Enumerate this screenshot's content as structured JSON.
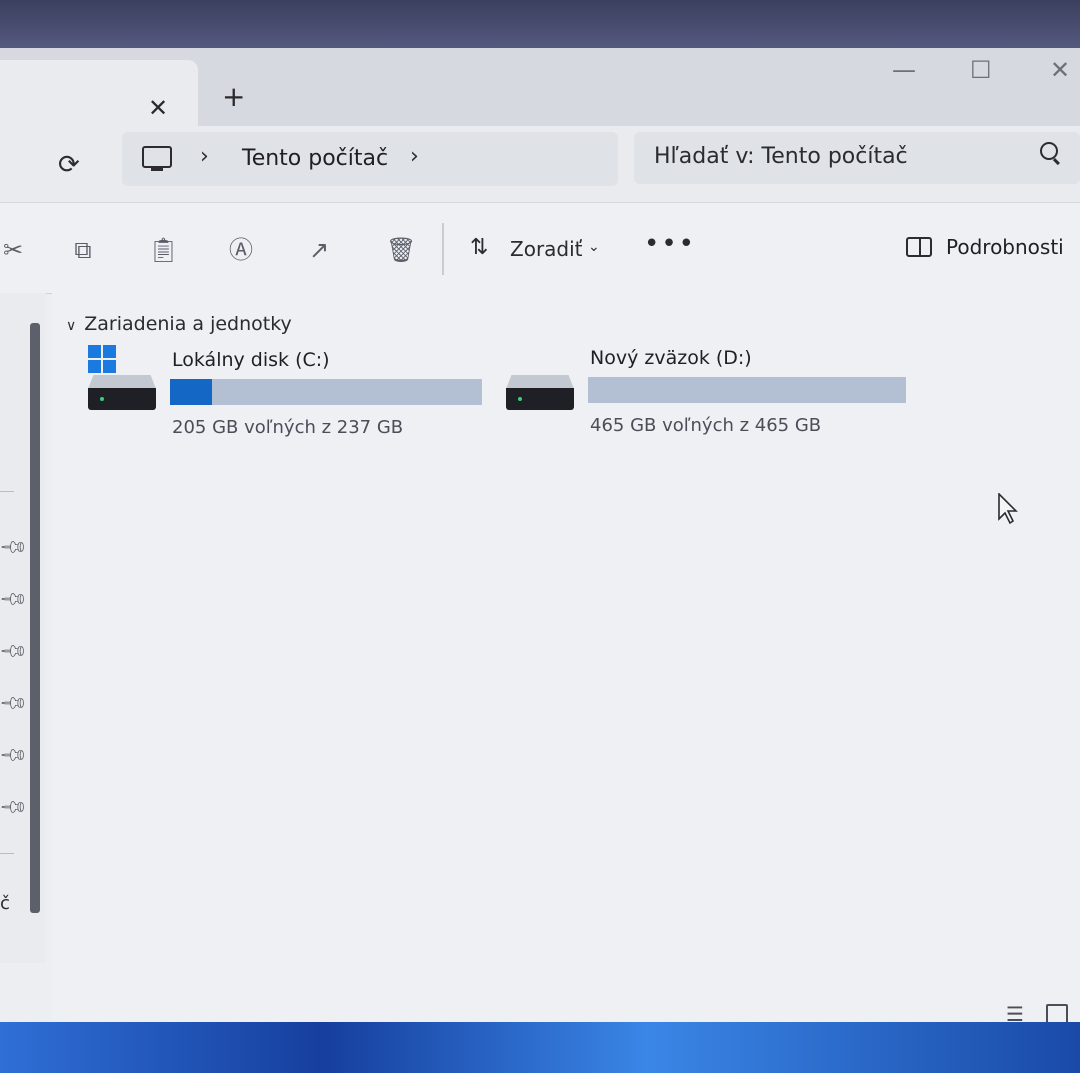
{
  "tab": {
    "close_glyph": "✕",
    "new_glyph": "+"
  },
  "window_controls": {
    "minimize": "—",
    "maximize": "☐",
    "close": "✕"
  },
  "address": {
    "breadcrumb": "Tento počítač",
    "search_placeholder": "Hľadať v: Tento počítač"
  },
  "toolbar": {
    "sort_label": "Zoradiť",
    "more_label": "•••",
    "details_label": "Podrobnosti"
  },
  "sidebar": {
    "letter": "č"
  },
  "section": {
    "title": "Zariadenia a jednotky"
  },
  "drives": [
    {
      "name": "Lokálny disk (C:)",
      "free_text": "205 GB voľných z 237 GB",
      "used_fraction": 0.135
    },
    {
      "name": "Nový zväzok (D:)",
      "free_text": "465 GB voľných z 465 GB",
      "used_fraction": 0.0
    }
  ],
  "colors": {
    "bar_fill": "#1467c4",
    "bar_track": "#b3bfd3",
    "accent": "#1a7ae0"
  }
}
